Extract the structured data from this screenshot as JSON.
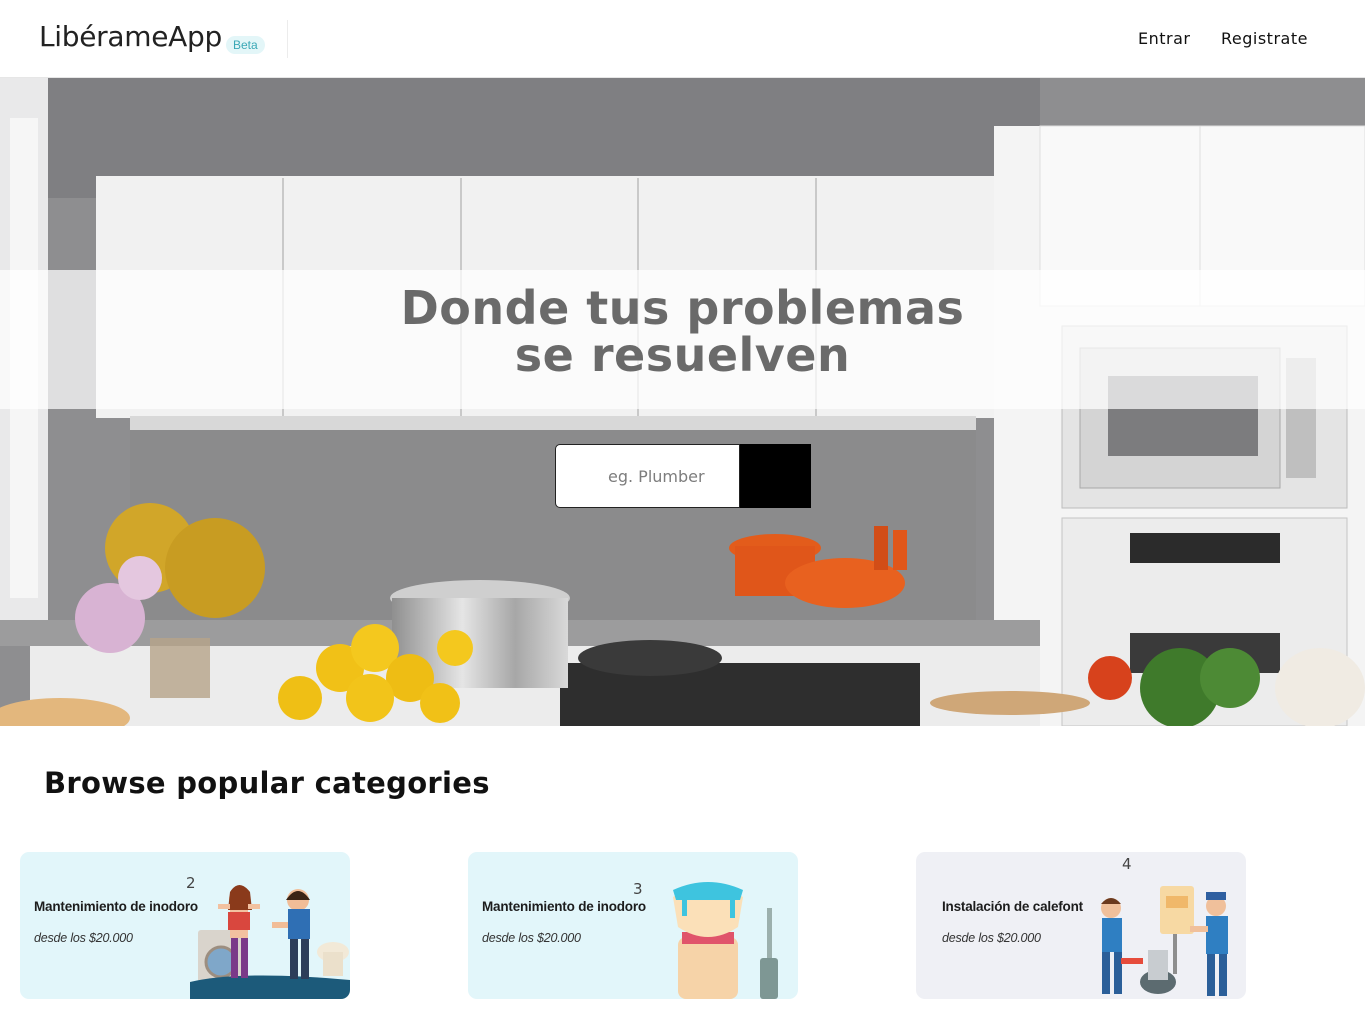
{
  "header": {
    "brand": "LibérameApp",
    "beta_badge": "Beta",
    "nav": {
      "login": "Entrar",
      "register": "Registrate"
    }
  },
  "hero": {
    "headline_line1": "Donde tus problemas",
    "headline_line2": "se resuelven",
    "search_placeholder": "eg. Plumber"
  },
  "categories": {
    "title": "Browse popular categories",
    "cards": [
      {
        "number": "2",
        "title": "Mantenimiento de inodoro",
        "price": "desde los $20.000",
        "bg": "#e2f6fa"
      },
      {
        "number": "3",
        "title": "Mantenimiento de inodoro",
        "price": "desde los $20.000",
        "bg": "#e2f6fa"
      },
      {
        "number": "4",
        "title": "Instalación de calefont",
        "price": "desde los $20.000",
        "bg": "#eff0f5"
      }
    ]
  },
  "colors": {
    "accent_beta_bg": "#e3f6f8",
    "accent_beta_text": "#3aa8b6",
    "search_button": "#000000"
  }
}
